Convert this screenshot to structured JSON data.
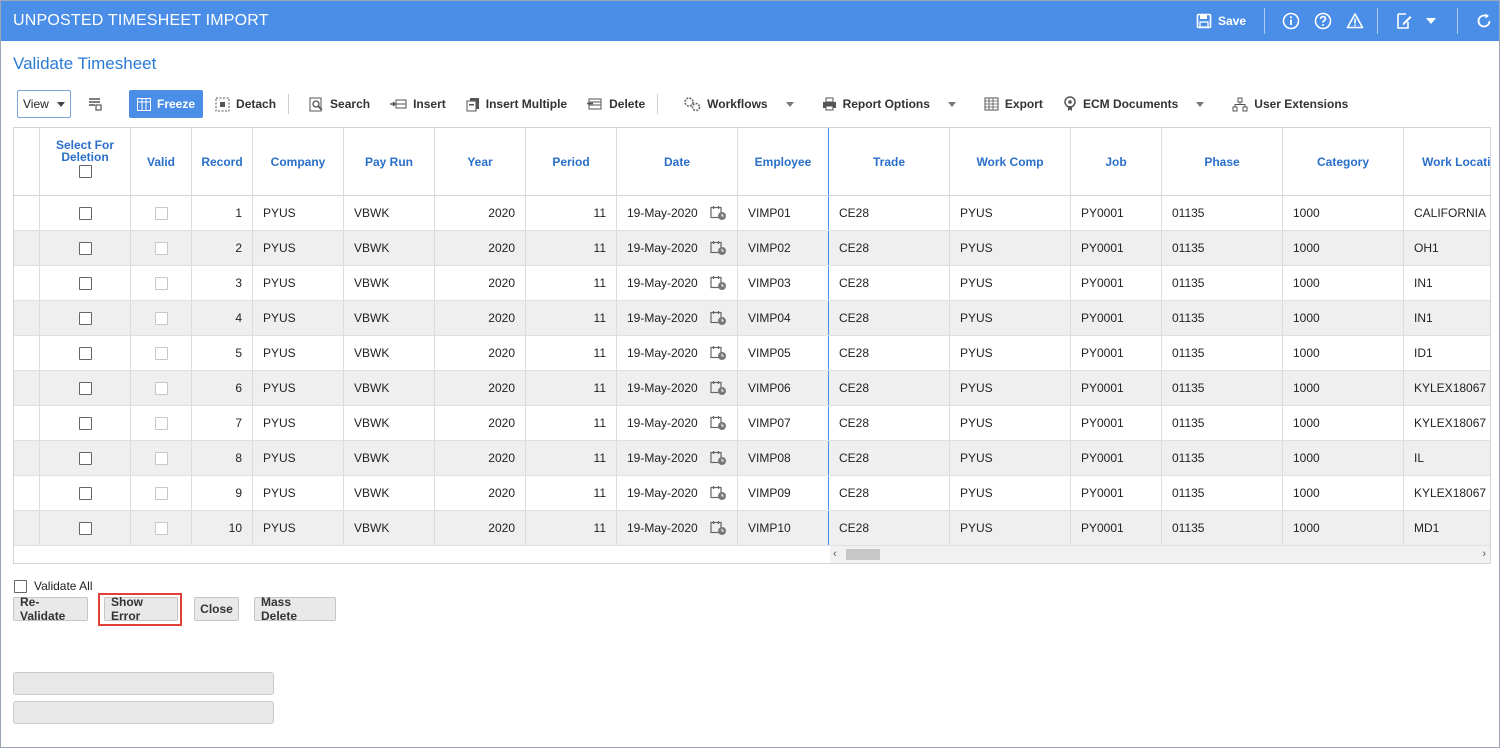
{
  "window": {
    "title": "UNPOSTED TIMESHEET IMPORT",
    "save_label": "Save",
    "icons": [
      "save-icon",
      "info-icon",
      "help-icon",
      "warning-icon",
      "edit-icon",
      "chevron-down-icon",
      "refresh-icon"
    ]
  },
  "page": {
    "heading": "Validate Timesheet"
  },
  "toolbar": {
    "view_label": "View",
    "items": [
      {
        "label": "Freeze",
        "icon": "freeze-icon"
      },
      {
        "label": "Detach",
        "icon": "detach-icon"
      },
      {
        "label": "Search",
        "icon": "search-icon"
      },
      {
        "label": "Insert",
        "icon": "insert-icon"
      },
      {
        "label": "Insert Multiple",
        "icon": "insert-multiple-icon"
      },
      {
        "label": "Delete",
        "icon": "delete-icon"
      },
      {
        "label": "Workflows",
        "icon": "workflows-icon"
      },
      {
        "label": "Report Options",
        "icon": "print-icon"
      },
      {
        "label": "Export",
        "icon": "export-icon"
      },
      {
        "label": "ECM Documents",
        "icon": "ecm-icon"
      },
      {
        "label": "User Extensions",
        "icon": "user-extensions-icon"
      }
    ]
  },
  "grid": {
    "columns": [
      "Select For Deletion",
      "Valid",
      "Record",
      "Company",
      "Pay Run",
      "Year",
      "Period",
      "Date",
      "Employee",
      "Trade",
      "Work Comp",
      "Job",
      "Phase",
      "Category",
      "Work Locati"
    ],
    "rows": [
      {
        "record": "1",
        "company": "PYUS",
        "pay_run": "VBWK",
        "year": "2020",
        "period": "11",
        "date": "19-May-2020",
        "employee": "VIMP01",
        "trade": "CE28",
        "work_comp": "PYUS",
        "job": "PY0001",
        "phase": "01135",
        "category": "1000",
        "work_location": "CALIFORNIA"
      },
      {
        "record": "2",
        "company": "PYUS",
        "pay_run": "VBWK",
        "year": "2020",
        "period": "11",
        "date": "19-May-2020",
        "employee": "VIMP02",
        "trade": "CE28",
        "work_comp": "PYUS",
        "job": "PY0001",
        "phase": "01135",
        "category": "1000",
        "work_location": "OH1"
      },
      {
        "record": "3",
        "company": "PYUS",
        "pay_run": "VBWK",
        "year": "2020",
        "period": "11",
        "date": "19-May-2020",
        "employee": "VIMP03",
        "trade": "CE28",
        "work_comp": "PYUS",
        "job": "PY0001",
        "phase": "01135",
        "category": "1000",
        "work_location": "IN1"
      },
      {
        "record": "4",
        "company": "PYUS",
        "pay_run": "VBWK",
        "year": "2020",
        "period": "11",
        "date": "19-May-2020",
        "employee": "VIMP04",
        "trade": "CE28",
        "work_comp": "PYUS",
        "job": "PY0001",
        "phase": "01135",
        "category": "1000",
        "work_location": "IN1"
      },
      {
        "record": "5",
        "company": "PYUS",
        "pay_run": "VBWK",
        "year": "2020",
        "period": "11",
        "date": "19-May-2020",
        "employee": "VIMP05",
        "trade": "CE28",
        "work_comp": "PYUS",
        "job": "PY0001",
        "phase": "01135",
        "category": "1000",
        "work_location": "ID1"
      },
      {
        "record": "6",
        "company": "PYUS",
        "pay_run": "VBWK",
        "year": "2020",
        "period": "11",
        "date": "19-May-2020",
        "employee": "VIMP06",
        "trade": "CE28",
        "work_comp": "PYUS",
        "job": "PY0001",
        "phase": "01135",
        "category": "1000",
        "work_location": "KYLEX18067"
      },
      {
        "record": "7",
        "company": "PYUS",
        "pay_run": "VBWK",
        "year": "2020",
        "period": "11",
        "date": "19-May-2020",
        "employee": "VIMP07",
        "trade": "CE28",
        "work_comp": "PYUS",
        "job": "PY0001",
        "phase": "01135",
        "category": "1000",
        "work_location": "KYLEX18067"
      },
      {
        "record": "8",
        "company": "PYUS",
        "pay_run": "VBWK",
        "year": "2020",
        "period": "11",
        "date": "19-May-2020",
        "employee": "VIMP08",
        "trade": "CE28",
        "work_comp": "PYUS",
        "job": "PY0001",
        "phase": "01135",
        "category": "1000",
        "work_location": "IL"
      },
      {
        "record": "9",
        "company": "PYUS",
        "pay_run": "VBWK",
        "year": "2020",
        "period": "11",
        "date": "19-May-2020",
        "employee": "VIMP09",
        "trade": "CE28",
        "work_comp": "PYUS",
        "job": "PY0001",
        "phase": "01135",
        "category": "1000",
        "work_location": "KYLEX18067"
      },
      {
        "record": "10",
        "company": "PYUS",
        "pay_run": "VBWK",
        "year": "2020",
        "period": "11",
        "date": "19-May-2020",
        "employee": "VIMP10",
        "trade": "CE28",
        "work_comp": "PYUS",
        "job": "PY0001",
        "phase": "01135",
        "category": "1000",
        "work_location": "MD1"
      }
    ]
  },
  "footer": {
    "validate_all_label": "Validate All",
    "buttons": {
      "revalidate": "Re-Validate",
      "show_error": "Show Error",
      "close": "Close",
      "mass_delete": "Mass Delete"
    }
  },
  "colors": {
    "titlebar": "#4a8ee8",
    "heading": "#2a7bd6",
    "highlight": "#e0403a"
  }
}
